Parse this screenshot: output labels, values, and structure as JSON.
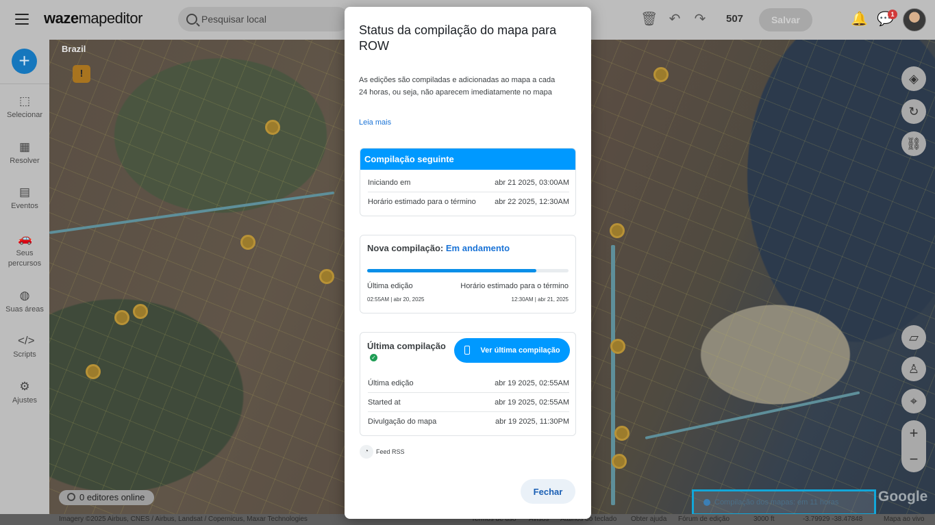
{
  "app": {
    "logo_bold": "waze",
    "logo_rest": "mapeditor"
  },
  "search": {
    "placeholder": "Pesquisar local"
  },
  "toolbar": {
    "edit_count": "507",
    "save_label": "Salvar",
    "notification_badge": "1"
  },
  "sidebar": {
    "items": [
      {
        "label": "Selecionar",
        "icon": "select-icon"
      },
      {
        "label": "Resolver",
        "icon": "resolve-icon"
      },
      {
        "label": "Eventos",
        "icon": "calendar-icon"
      },
      {
        "label": "Seus percursos",
        "icon": "car-icon"
      },
      {
        "label": "Suas áreas",
        "icon": "globe-icon"
      },
      {
        "label": "Scripts",
        "icon": "code-icon"
      },
      {
        "label": "Ajustes",
        "icon": "gear-icon"
      }
    ]
  },
  "map": {
    "country_label": "Brazil",
    "online_editors": "0 editores online",
    "compile_chip": "Compilação dos mapas: em 11 horas",
    "google": "Google",
    "footer": {
      "imagery": "Imagery ©2025 Airbus, CNES / Airbus, Landsat / Copernicus, Maxar Technologies",
      "terms": "Termos de uso",
      "notices": "Avisos",
      "shortcuts": "Atalhos do teclado",
      "help": "Obter ajuda",
      "forum": "Fórum de edição",
      "scale": "3000 ft",
      "coords": "-3.79929 -38.47848",
      "live_map": "Mapa ao vivo"
    }
  },
  "modal": {
    "title": "Status da compilação do mapa para ROW",
    "description": "As edições são compiladas e adicionadas ao mapa a cada 24 horas, ou seja, não aparecem imediatamente no mapa",
    "read_more": "Leia mais",
    "next": {
      "header": "Compilação seguinte",
      "rows": [
        {
          "label": "Iniciando em",
          "value": "abr 21 2025, 03:00AM"
        },
        {
          "label": "Horário estimado para o término",
          "value": "abr 22 2025, 12:30AM"
        }
      ]
    },
    "new": {
      "title_prefix": "Nova compilação:",
      "status": "Em andamento",
      "progress_percent": 84,
      "last_edit_label": "Última edição",
      "last_edit_value": "02:55AM | abr 20, 2025",
      "eta_label": "Horário estimado para o término",
      "eta_value": "12:30AM | abr 21, 2025"
    },
    "last": {
      "title": "Última compilação",
      "view_button": "Ver última compilação",
      "rows": [
        {
          "label": "Última edição",
          "value": "abr 19 2025, 02:55AM"
        },
        {
          "label": "Started at",
          "value": "abr 19 2025, 02:55AM"
        },
        {
          "label": "Divulgação do mapa",
          "value": "abr 19 2025, 11:30PM"
        }
      ]
    },
    "rss": "Feed RSS",
    "close": "Fechar"
  }
}
